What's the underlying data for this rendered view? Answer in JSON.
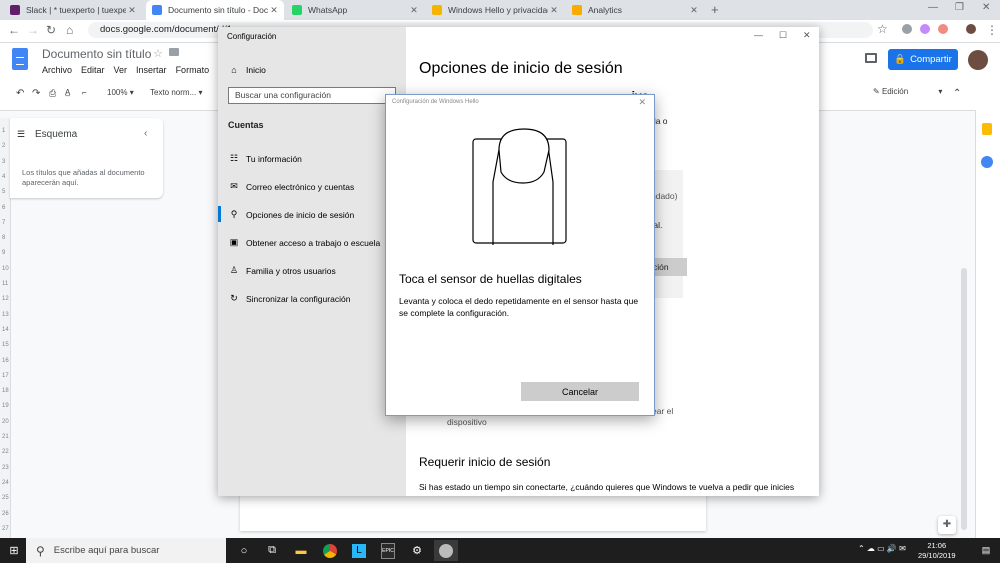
{
  "browser": {
    "tabs": [
      {
        "title": "Slack | * tuexperto | tuexperto | Vodafone",
        "favicon_color": "#611f69",
        "active": false
      },
      {
        "title": "Documento sin título - Documentos",
        "favicon_color": "#4285f4",
        "active": true
      },
      {
        "title": "WhatsApp",
        "favicon_color": "#25d366",
        "active": false
      },
      {
        "title": "Windows Hello y privacidad: privacidad",
        "favicon_color": "#f4b400",
        "active": false
      },
      {
        "title": "Analytics",
        "favicon_color": "#f9ab00",
        "active": false
      }
    ],
    "url": "docs.google.com/document/d/1"
  },
  "docs": {
    "title": "Documento sin título",
    "menu": [
      "Archivo",
      "Editar",
      "Ver",
      "Insertar",
      "Formato",
      "Her"
    ],
    "share_label": "Compartir",
    "zoom": "100%",
    "style": "Texto norm...",
    "mode": "Edición",
    "outline_title": "Esquema",
    "outline_hint": "Los títulos que añadas al documento aparecerán aquí."
  },
  "settings": {
    "window_title": "Configuración",
    "home": "Inicio",
    "search_placeholder": "Buscar una configuración",
    "section": "Cuentas",
    "nav": [
      {
        "label": "Tu información",
        "icon": "person-card-icon"
      },
      {
        "label": "Correo electrónico y cuentas",
        "icon": "mail-icon"
      },
      {
        "label": "Opciones de inicio de sesión",
        "icon": "key-icon",
        "selected": true
      },
      {
        "label": "Obtener acceso a trabajo o escuela",
        "icon": "briefcase-icon"
      },
      {
        "label": "Familia y otros usuarios",
        "icon": "person-icon"
      },
      {
        "label": "Sincronizar la configuración",
        "icon": "sync-icon"
      }
    ],
    "page_title": "Opciones de inicio de sesión",
    "subheading_partial": "...ivo",
    "frag_rla": "rla o",
    "frag_ndado": "ndado)",
    "frag_tal": "tal.",
    "frag_cion": "ción",
    "frag_ear_el": "ear el",
    "frag_dispositivo": "dispositivo",
    "require_heading": "Requerir inicio de sesión",
    "require_text": "Si has estado un tiempo sin conectarte, ¿cuándo quieres que Windows te vuelva a pedir que inicies"
  },
  "hello_dialog": {
    "title": "Configuración de Windows Hello",
    "heading": "Toca el sensor de huellas digitales",
    "body": "Levanta y coloca el dedo repetidamente en el sensor hasta que se complete la configuración.",
    "cancel_label": "Cancelar"
  },
  "taskbar": {
    "search_placeholder": "Escribe aquí para buscar",
    "time": "21:06",
    "date": "29/10/2019"
  }
}
